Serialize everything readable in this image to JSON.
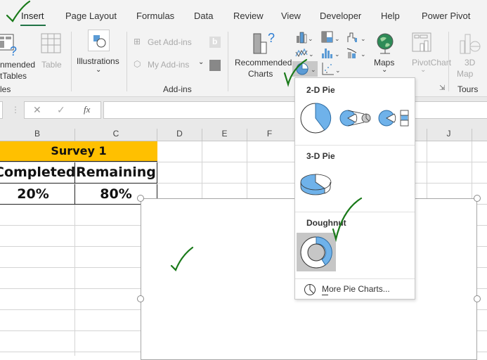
{
  "tabs": [
    {
      "label": "Insert",
      "active": true
    },
    {
      "label": "Page Layout"
    },
    {
      "label": "Formulas"
    },
    {
      "label": "Data"
    },
    {
      "label": "Review"
    },
    {
      "label": "View"
    },
    {
      "label": "Developer"
    },
    {
      "label": "Help"
    },
    {
      "label": "Power Pivot"
    }
  ],
  "ribbon": {
    "tables_group": {
      "recommended_line1": "nmended",
      "recommended_line2": "tTables",
      "table": "Table",
      "group_label": "les"
    },
    "illustrations": {
      "label": "Illustrations"
    },
    "addins": {
      "get": "Get Add-ins",
      "my": "My Add-ins",
      "group_label": "Add-ins"
    },
    "charts": {
      "recommended_line1": "Recommended",
      "recommended_line2": "Charts",
      "maps": "Maps",
      "pivotchart": "PivotChart"
    },
    "tours": {
      "map_line1": "3D",
      "map_line2": "Map",
      "group_label": "Tours"
    }
  },
  "formula_bar": {
    "fx_label": "fx",
    "value": ""
  },
  "columns": [
    "B",
    "C",
    "D",
    "E",
    "F",
    "J"
  ],
  "sheet": {
    "title": "Survey 1",
    "headers": [
      "Completed",
      "Remaining"
    ],
    "values": [
      "20%",
      "80%"
    ],
    "title_fill": "#ffc000"
  },
  "pie_menu": {
    "sections": [
      {
        "label": "2-D Pie",
        "items": [
          "pie",
          "pie-of-pie",
          "bar-of-pie"
        ]
      },
      {
        "label": "3-D Pie",
        "items": [
          "3d-pie"
        ]
      },
      {
        "label": "Doughnut",
        "items": [
          "doughnut"
        ]
      }
    ],
    "more_label": "More Pie Charts...",
    "selected": "doughnut",
    "accent": "#6fb2ea"
  },
  "annotation_color": "#1a7a1a"
}
